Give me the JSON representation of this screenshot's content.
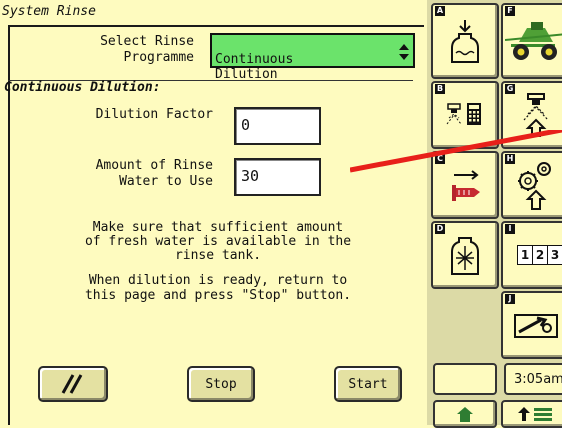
{
  "page": {
    "title": "System Rinse"
  },
  "rinse_programme": {
    "label": "Select Rinse\nProgramme",
    "selected": "Continuous\nDilution"
  },
  "section": {
    "heading": "Continuous Dilution:"
  },
  "dilution_factor": {
    "label": "Dilution Factor",
    "value": "0"
  },
  "rinse_water": {
    "label": "Amount of Rinse\nWater to Use",
    "value": "30"
  },
  "messages": {
    "line1": "Make sure that sufficient amount",
    "line2": "of fresh water is available in the",
    "line3": "rinse tank.",
    "line4": "When dilution is ready, return to",
    "line5": "this page and press \"Stop\" button."
  },
  "buttons": {
    "cancel_icon": "slash-icon",
    "stop": "Stop",
    "start": "Start"
  },
  "sidebar": {
    "keys": [
      "A",
      "B",
      "C",
      "D",
      "E",
      "F",
      "G",
      "H",
      "I",
      "J"
    ],
    "counter_digits": [
      "1",
      "2",
      "3"
    ],
    "time": "3:05am",
    "icons": [
      "tank-fill-icon",
      "sprayer-machine-icon",
      "nozzle-calculator-icon",
      "spray-nozzle-icon",
      "boom-pump-icon",
      "settings-gears-icon",
      "tank-agitation-icon",
      "counter-icon",
      "wrench-diagnostics-icon",
      "home-icon",
      "menu-icon"
    ]
  },
  "colors": {
    "background": "#fefbbf",
    "selected_field": "#6be36b",
    "annotation_line": "#e8201a",
    "side_panel": "#dcdaa6"
  }
}
